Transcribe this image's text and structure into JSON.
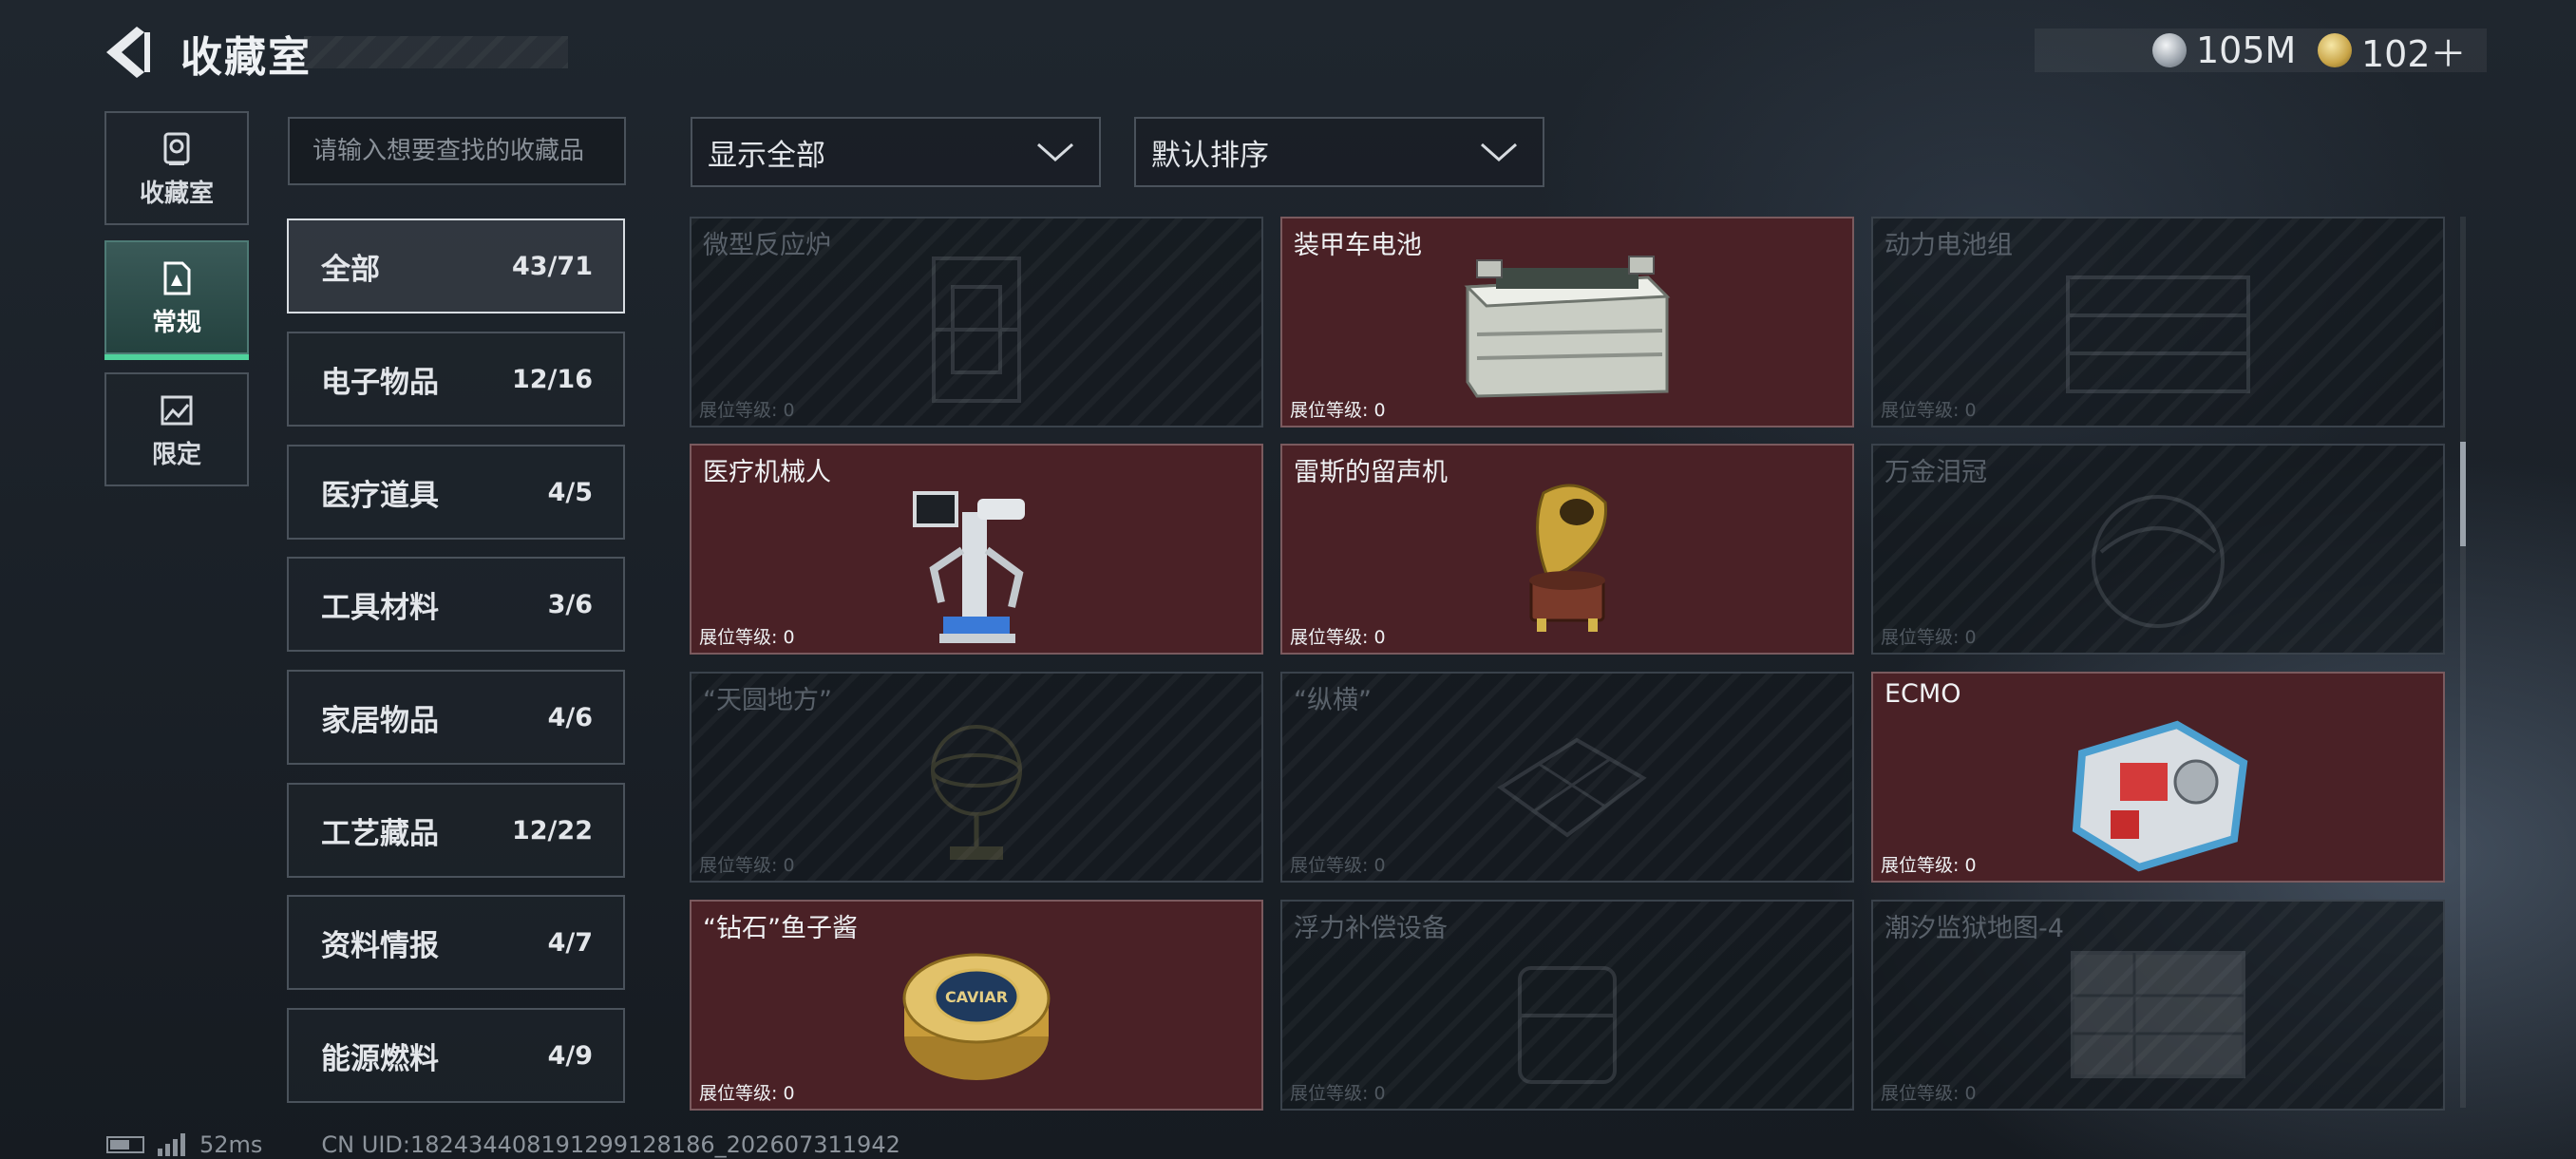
{
  "header": {
    "title": "收藏室",
    "back_icon": "back-arrow-icon"
  },
  "currency": [
    {
      "icon": "silver-coin-icon",
      "value": "105M"
    },
    {
      "icon": "gold-coin-icon",
      "value": "102＋"
    }
  ],
  "side_tabs": [
    {
      "label": "收藏室",
      "icon": "vault-icon",
      "active": false
    },
    {
      "label": "常规",
      "icon": "document-icon",
      "active": true
    },
    {
      "label": "限定",
      "icon": "image-icon",
      "active": false
    }
  ],
  "search": {
    "placeholder": "请输入想要查找的收藏品"
  },
  "categories": [
    {
      "label": "全部",
      "count": "43/71",
      "active": true
    },
    {
      "label": "电子物品",
      "count": "12/16"
    },
    {
      "label": "医疗道具",
      "count": "4/5"
    },
    {
      "label": "工具材料",
      "count": "3/6"
    },
    {
      "label": "家居物品",
      "count": "4/6"
    },
    {
      "label": "工艺藏品",
      "count": "12/22"
    },
    {
      "label": "资料情报",
      "count": "4/7"
    },
    {
      "label": "能源燃料",
      "count": "4/9"
    }
  ],
  "filters": {
    "display": {
      "label": "显示全部"
    },
    "sort": {
      "label": "默认排序"
    }
  },
  "level_label": "展位等级: 0",
  "items": [
    {
      "name": "微型反应炉",
      "owned": false,
      "icon": "reactor-icon"
    },
    {
      "name": "装甲车电池",
      "owned": true,
      "icon": "battery-icon"
    },
    {
      "name": "动力电池组",
      "owned": false,
      "icon": "battery-pack-icon"
    },
    {
      "name": "医疗机械人",
      "owned": true,
      "icon": "medical-robot-icon"
    },
    {
      "name": "雷斯的留声机",
      "owned": true,
      "icon": "gramophone-icon"
    },
    {
      "name": "万金泪冠",
      "owned": false,
      "icon": "crown-icon"
    },
    {
      "name": "“天圆地方”",
      "owned": false,
      "icon": "globe-icon"
    },
    {
      "name": "“纵横”",
      "owned": false,
      "icon": "chessboard-icon"
    },
    {
      "name": "ECMO",
      "owned": true,
      "icon": "ecmo-icon"
    },
    {
      "name": "“钻石”鱼子酱",
      "owned": true,
      "icon": "caviar-tin-icon",
      "tin_text": "CAVIAR"
    },
    {
      "name": "浮力补偿设备",
      "owned": false,
      "icon": "buoyancy-device-icon"
    },
    {
      "name": "潮汐监狱地图-4",
      "owned": false,
      "icon": "map-icon"
    }
  ],
  "footer": {
    "ping": "52ms",
    "uid": "CN UID:1824344081912991281​86_202607311942"
  }
}
